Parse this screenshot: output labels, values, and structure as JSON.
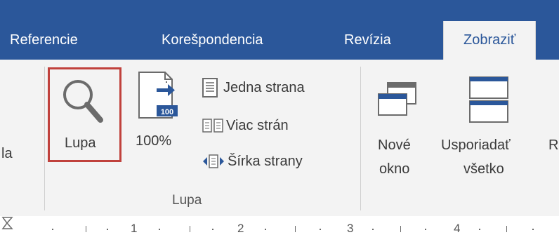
{
  "tabs": [
    {
      "label": "Referencie"
    },
    {
      "label": "Korešpondencia"
    },
    {
      "label": "Revízia"
    },
    {
      "label": "Zobraziť"
    }
  ],
  "ribbon": {
    "left_partial_label": "la",
    "zoom_button": {
      "label": "Lupa",
      "icon": "magnifier-icon"
    },
    "zoom100_button": {
      "label": "100%",
      "icon_text": "100"
    },
    "one_page": {
      "label": "Jedna strana"
    },
    "multiple_pages": {
      "label": "Viac strán"
    },
    "page_width": {
      "label": "Šírka strany"
    },
    "group_label": "Lupa",
    "new_window": {
      "line1": "Nové",
      "line2": "okno"
    },
    "arrange_all": {
      "line1": "Usporiadať",
      "line2": "všetko"
    },
    "right_partial_label": "R"
  },
  "ruler": {
    "numbers": [
      "1",
      "2",
      "3",
      "4"
    ]
  },
  "colors": {
    "accent": "#2b579a",
    "highlight": "#c0413c",
    "ribbon_bg": "#f3f3f3"
  }
}
